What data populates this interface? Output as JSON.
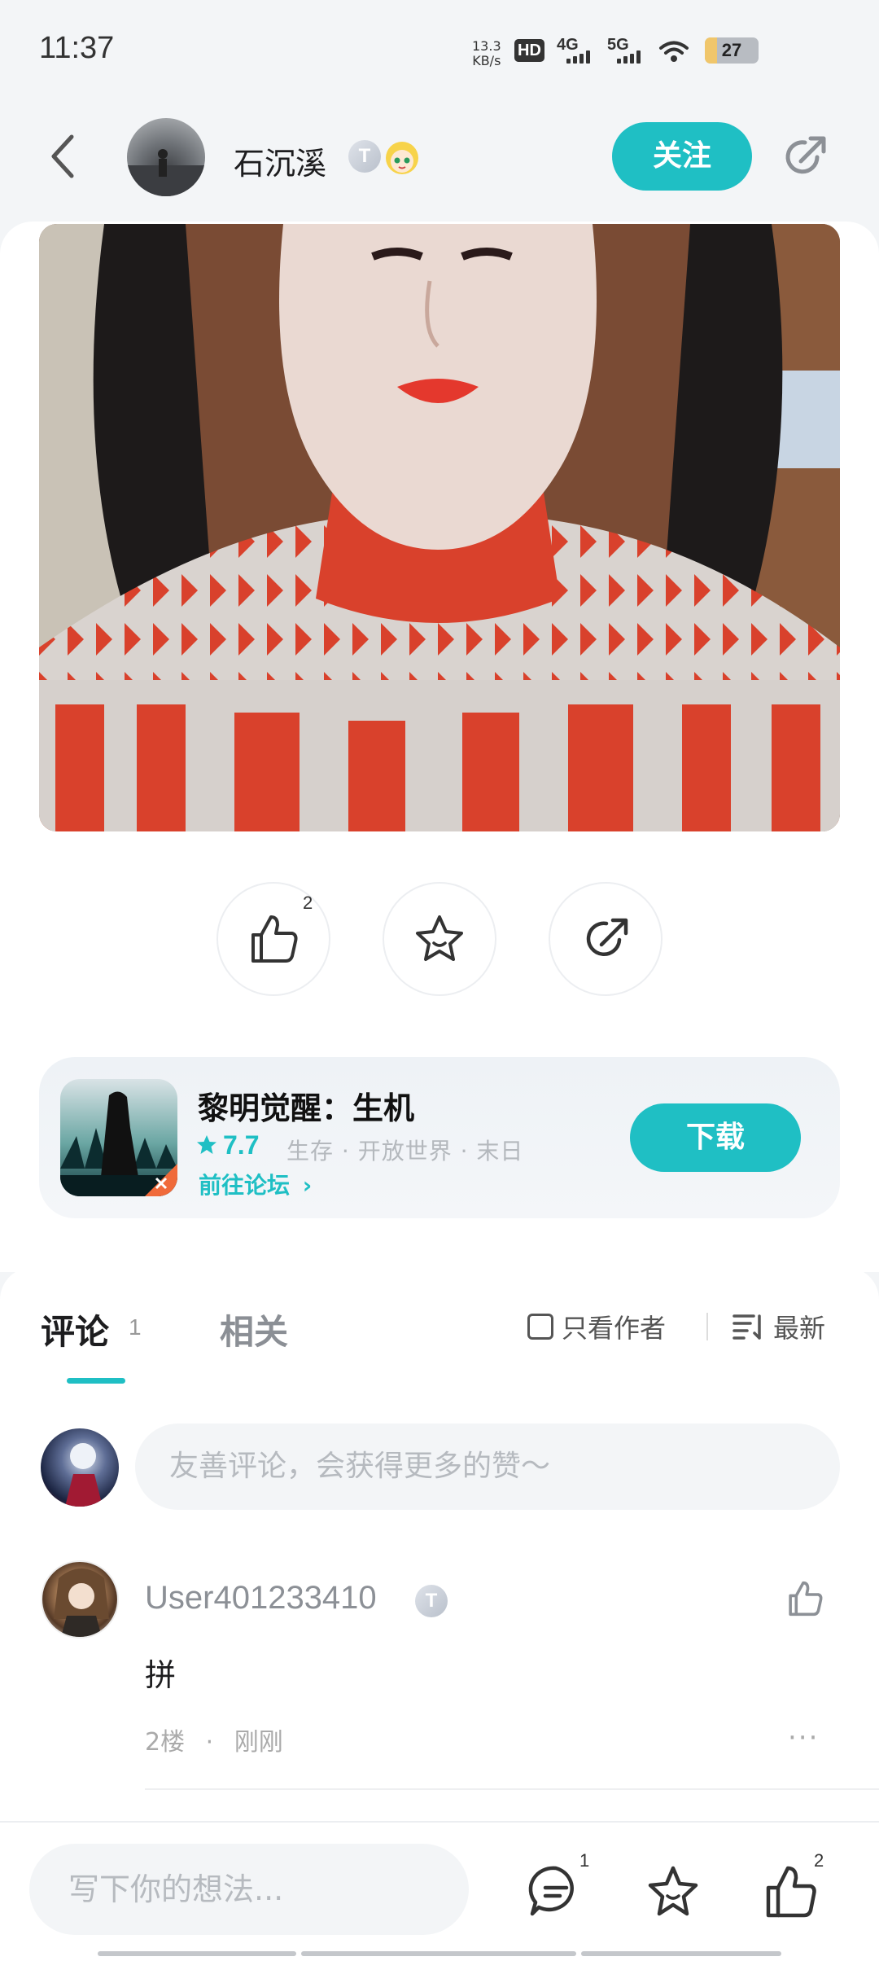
{
  "status_bar": {
    "time": "11:37",
    "net_speed_value": "13.3",
    "net_speed_unit": "KB/s",
    "hd_label": "HD",
    "sim1_label": "4G",
    "sim2_label": "5G",
    "battery": "27"
  },
  "header": {
    "author_name": "石沉溪",
    "author_badge": "T",
    "follow_label": "关注",
    "icons": [
      "back-icon",
      "share-icon"
    ]
  },
  "actions": {
    "like_count": "2"
  },
  "game_card": {
    "title": "黎明觉醒：生机",
    "rating": "7.7",
    "tags": "生存 · 开放世界 · 末日",
    "forum_link": "前往论坛",
    "download_label": "下载"
  },
  "comments": {
    "tab_comments": "评论",
    "tab_comments_count": "1",
    "tab_related": "相关",
    "author_only_label": "只看作者",
    "sort_label": "最新",
    "input_placeholder": "友善评论，会获得更多的赞～",
    "items": [
      {
        "user": "User401233410",
        "badge": "T",
        "text": "拼",
        "floor": "2楼",
        "time": "刚刚"
      }
    ]
  },
  "bottom_bar": {
    "input_placeholder": "写下你的想法...",
    "comment_count": "1",
    "like_count": "2"
  },
  "colors": {
    "accent": "#1fbfc4",
    "background": "#f3f5f7"
  }
}
